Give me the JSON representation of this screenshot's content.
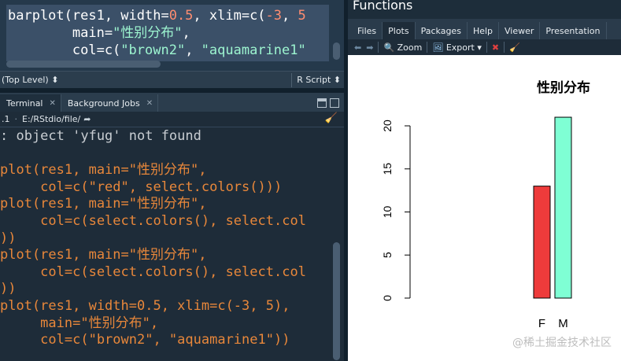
{
  "editor": {
    "lines": [
      [
        {
          "t": "barplot(res1, width=",
          "c": ""
        },
        {
          "t": "0.5",
          "c": "num"
        },
        {
          "t": ", xlim=c(",
          "c": ""
        },
        {
          "t": "-3",
          "c": "num"
        },
        {
          "t": ", ",
          "c": ""
        },
        {
          "t": "5",
          "c": "num"
        }
      ],
      [
        {
          "t": "        main=",
          "c": ""
        },
        {
          "t": "\"性别分布\"",
          "c": "str"
        },
        {
          "t": ",",
          "c": ""
        }
      ],
      [
        {
          "t": "        col=c(",
          "c": ""
        },
        {
          "t": "\"brown2\"",
          "c": "str"
        },
        {
          "t": ", ",
          "c": ""
        },
        {
          "t": "\"aquamarine1\"",
          "c": "str"
        },
        {
          "t": "",
          "c": ""
        }
      ]
    ],
    "scope": "(Top Level)",
    "file_type": "R Script"
  },
  "console_tabs": [
    {
      "label": "Terminal",
      "active": true
    },
    {
      "label": "Background Jobs",
      "active": false
    }
  ],
  "path": "E:/RStdio/file/",
  "path_version": ".1",
  "console_lines": [
    {
      "t": ": object 'yfug' not found",
      "c": "err"
    },
    {
      "t": "",
      "c": ""
    },
    {
      "t": "plot(res1, main=\"性别分布\",",
      "c": ""
    },
    {
      "t": "     col=c(\"red\", select.colors()))",
      "c": ""
    },
    {
      "t": "plot(res1, main=\"性别分布\",",
      "c": ""
    },
    {
      "t": "     col=c(select.colors(), select.col",
      "c": ""
    },
    {
      "t": "))",
      "c": ""
    },
    {
      "t": "plot(res1, main=\"性别分布\",",
      "c": ""
    },
    {
      "t": "     col=c(select.colors(), select.col",
      "c": ""
    },
    {
      "t": "))",
      "c": ""
    },
    {
      "t": "plot(res1, width=0.5, xlim=c(-3, 5),",
      "c": ""
    },
    {
      "t": "     main=\"性别分布\",",
      "c": ""
    },
    {
      "t": "     col=c(\"brown2\", \"aquamarine1\"))",
      "c": ""
    }
  ],
  "right_pane": {
    "header": "Functions",
    "tabs": [
      {
        "label": "Files",
        "active": false
      },
      {
        "label": "Plots",
        "active": true
      },
      {
        "label": "Packages",
        "active": false
      },
      {
        "label": "Help",
        "active": false
      },
      {
        "label": "Viewer",
        "active": false
      },
      {
        "label": "Presentation",
        "active": false
      }
    ],
    "toolbar": {
      "zoom": "Zoom",
      "export": "Export"
    },
    "watermark": "@稀土掘金技术社区"
  },
  "chart_data": {
    "type": "bar",
    "title": "性别分布",
    "categories": [
      "F",
      "M"
    ],
    "values": [
      13,
      21
    ],
    "colors": [
      "#ee3b3b",
      "#7fffd4"
    ],
    "ylim": [
      0,
      20
    ],
    "yticks": [
      0,
      5,
      10,
      15,
      20
    ],
    "grid": false
  }
}
